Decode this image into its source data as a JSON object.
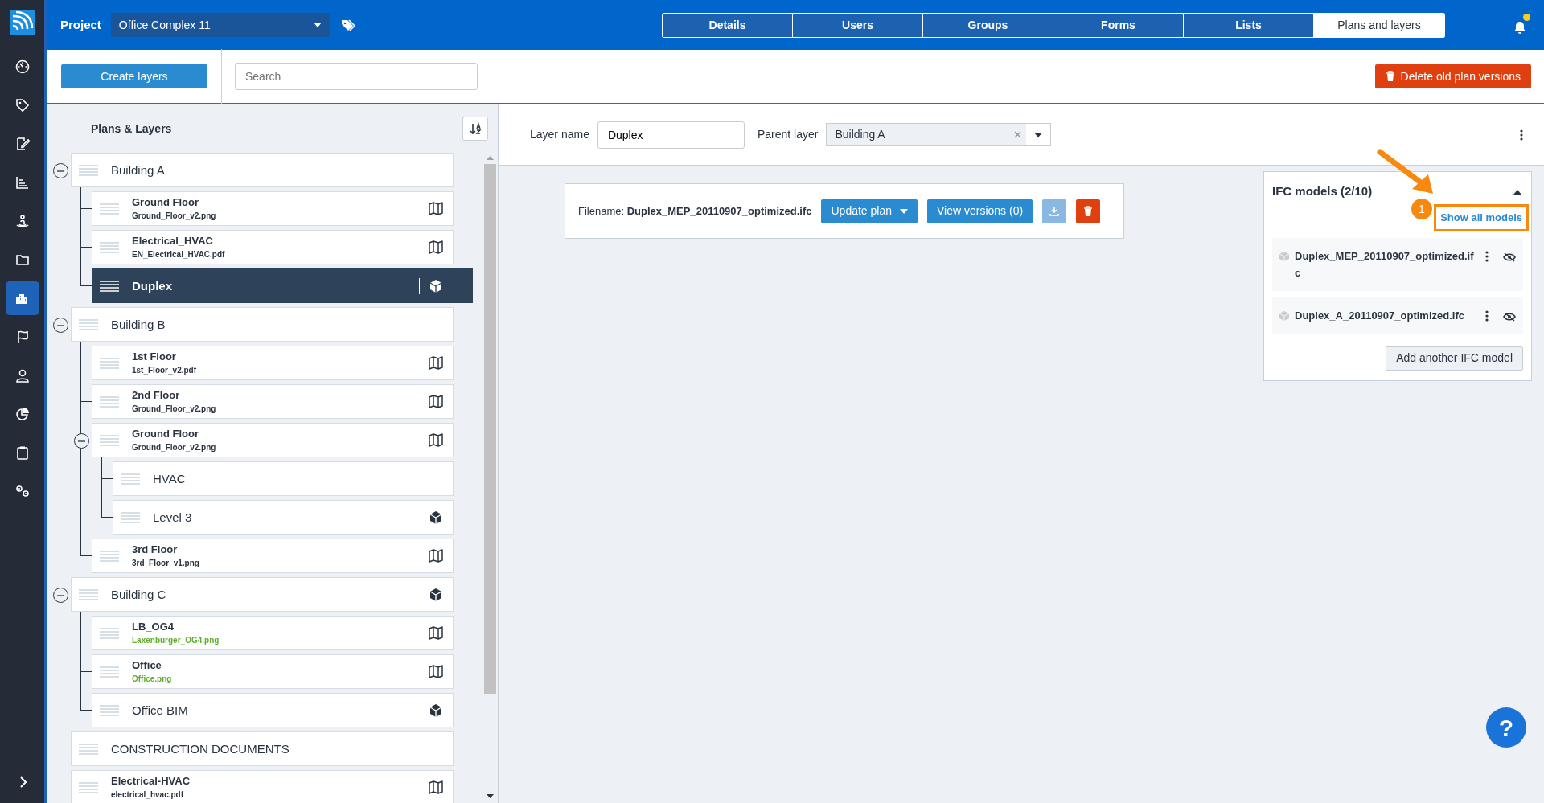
{
  "sidebar": {
    "items": [
      {
        "selected": false
      },
      {
        "selected": false
      },
      {
        "selected": false
      },
      {
        "selected": false
      },
      {
        "selected": false
      },
      {
        "selected": false
      },
      {
        "selected": true
      },
      {
        "selected": false
      },
      {
        "selected": false
      },
      {
        "selected": false
      },
      {
        "selected": false
      },
      {
        "selected": false
      }
    ]
  },
  "top_bar": {
    "project_label": "Project",
    "project": "Office Complex 11",
    "tabs": [
      {
        "label": "Details",
        "selected": false
      },
      {
        "label": "Users",
        "selected": false
      },
      {
        "label": "Groups",
        "selected": false
      },
      {
        "label": "Forms",
        "selected": false
      },
      {
        "label": "Lists",
        "selected": false
      },
      {
        "label": "Plans and layers",
        "selected": true
      }
    ],
    "has_notification": true
  },
  "toolbar": {
    "create_button": "Create layers",
    "search": {
      "placeholder": "Search"
    },
    "delete_button": "Delete old plan versions"
  },
  "tree": {
    "title": "Plans & Layers",
    "items": [
      {
        "name": "Building A",
        "kind": "folder",
        "selected": false,
        "expanded": true,
        "children": [
          {
            "name": "Ground Floor",
            "file": "Ground_Floor_v2.png",
            "color": "#2a3441",
            "kind": "plan",
            "selected": false
          },
          {
            "name": "Electrical_HVAC",
            "file": "EN_Electrical_HVAC.pdf",
            "color": "#2a3441",
            "kind": "plan",
            "selected": false
          },
          {
            "name": "Duplex",
            "kind": "bim",
            "selected": true
          }
        ]
      },
      {
        "name": "Building B",
        "kind": "folder",
        "selected": false,
        "expanded": true,
        "children": [
          {
            "name": "1st Floor",
            "file": "1st_Floor_v2.pdf",
            "color": "#2a3441",
            "kind": "plan",
            "selected": false
          },
          {
            "name": "2nd Floor",
            "file": "Ground_Floor_v2.png",
            "color": "#2a3441",
            "kind": "plan",
            "selected": false
          },
          {
            "name": "Ground Floor",
            "file": "Ground_Floor_v2.png",
            "color": "#2a3441",
            "kind": "plan",
            "selected": false,
            "expanded": true,
            "children": [
              {
                "name": "HVAC",
                "kind": "folder",
                "selected": false
              },
              {
                "name": "Level 3",
                "kind": "bim",
                "selected": false
              }
            ]
          },
          {
            "name": "3rd Floor",
            "file": "3rd_Floor_v1.png",
            "color": "#2a3441",
            "kind": "plan",
            "selected": false
          }
        ]
      },
      {
        "name": "Building C",
        "kind": "bim",
        "selected": false,
        "expanded": true,
        "children": [
          {
            "name": "LB_OG4",
            "file": "Laxenburger_OG4.png",
            "color": "#5fae2a",
            "kind": "plan",
            "selected": false
          },
          {
            "name": "Office",
            "file": "Office.png",
            "color": "#5fae2a",
            "kind": "plan",
            "selected": false
          },
          {
            "name": "Office BIM",
            "kind": "bim",
            "selected": false
          }
        ]
      },
      {
        "name": "CONSTRUCTION DOCUMENTS",
        "kind": "folder",
        "selected": false
      },
      {
        "name": "Electrical-HVAC",
        "file": "electrical_hvac.pdf",
        "color": "#2a3441",
        "kind": "plan",
        "selected": false
      }
    ]
  },
  "layer_form": {
    "name_label": "Layer name",
    "name_value": "Duplex",
    "parent_label": "Parent layer",
    "parent_value": "Building A"
  },
  "file_card": {
    "filename": "Filename: **Duplex_MEP_20110907_optimized.ifc**",
    "update_button": "Update plan",
    "versions_button": "View versions (0)"
  },
  "ifc_panel": {
    "title": "IFC models (2/10)",
    "expanded": true,
    "show_all_link": "Show all models",
    "models": [
      {
        "name": "Duplex_MEP_20110907_optimized.ifc"
      },
      {
        "name": "Duplex_A_20110907_optimized.ifc"
      }
    ],
    "add_button": "Add another IFC model"
  },
  "annotation": {
    "badge": "1"
  },
  "help_button": {
    "label": "?"
  }
}
